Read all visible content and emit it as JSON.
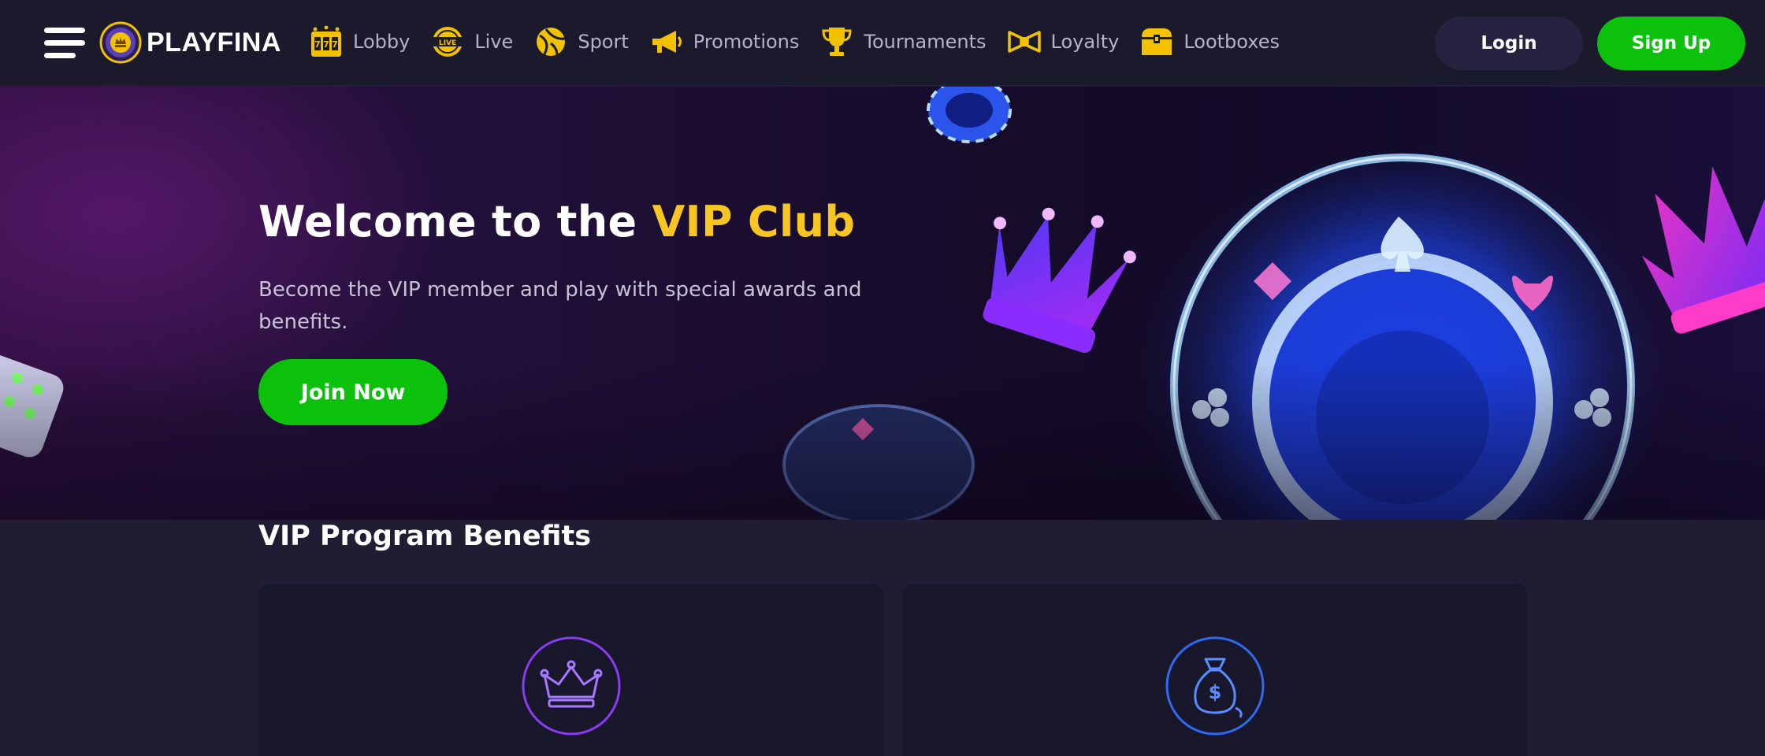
{
  "header": {
    "logo_text": "PLAYFINA",
    "nav": [
      {
        "label": "Lobby",
        "icon": "slot-machine-icon"
      },
      {
        "label": "Live",
        "icon": "live-badge-icon"
      },
      {
        "label": "Sport",
        "icon": "ball-icon"
      },
      {
        "label": "Promotions",
        "icon": "megaphone-icon"
      },
      {
        "label": "Tournaments",
        "icon": "trophy-icon"
      },
      {
        "label": "Loyalty",
        "icon": "bow-tie-icon"
      },
      {
        "label": "Lootboxes",
        "icon": "treasure-chest-icon"
      }
    ],
    "login_label": "Login",
    "signup_label": "Sign Up"
  },
  "hero": {
    "title_prefix": "Welcome to the ",
    "title_accent": "VIP Club",
    "subtitle": "Become the VIP member and play with special awards and benefits.",
    "cta_label": "Join Now"
  },
  "benefits": {
    "title": "VIP Program Benefits",
    "cards": [
      {
        "icon": "crown-icon"
      },
      {
        "icon": "money-bag-icon"
      }
    ]
  },
  "colors": {
    "accent_yellow": "#f7c623",
    "brand_green": "#0cc10c",
    "nav_icon_yellow": "#f2c200",
    "page_bg": "#201c34",
    "header_bg": "#1b1a2c",
    "card_bg": "#19172b",
    "crown_ring": "#8b3cf0",
    "bag_ring": "#2e6bf0"
  }
}
